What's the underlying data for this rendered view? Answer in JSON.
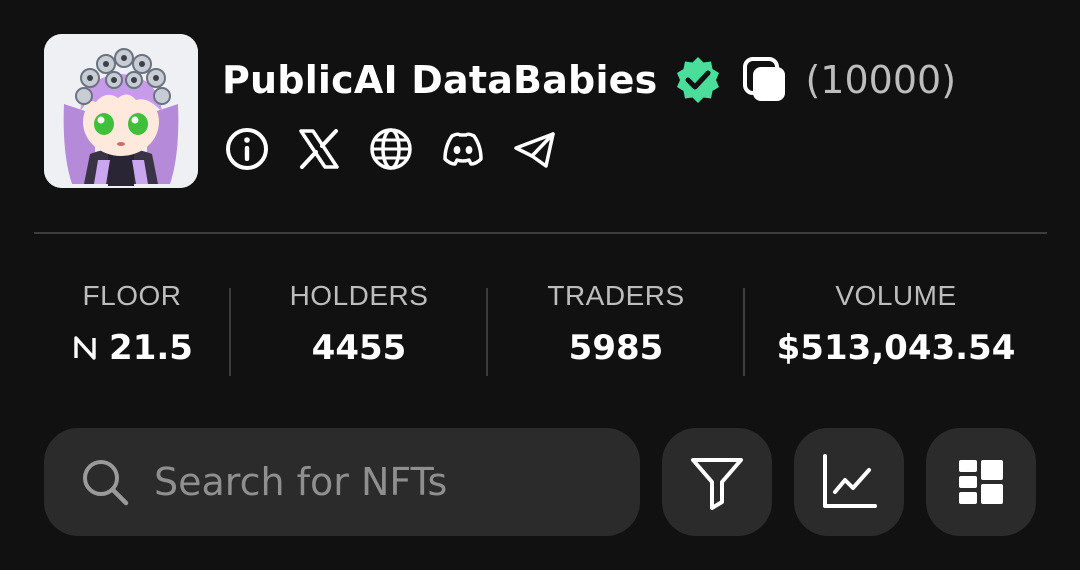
{
  "collection": {
    "name": "PublicAI DataBabies",
    "supply": "(10000)",
    "verified_color": "#4ade9a"
  },
  "socials": [
    {
      "name": "info-icon"
    },
    {
      "name": "x-twitter-icon"
    },
    {
      "name": "globe-icon"
    },
    {
      "name": "discord-icon"
    },
    {
      "name": "telegram-icon"
    }
  ],
  "stats": {
    "floor": {
      "label": "FLOOR",
      "value": "21.5",
      "currency_icon": "near-icon"
    },
    "holders": {
      "label": "HOLDERS",
      "value": "4455"
    },
    "traders": {
      "label": "TRADERS",
      "value": "5985"
    },
    "volume": {
      "label": "VOLUME",
      "value": "$513,043.54"
    }
  },
  "search": {
    "placeholder": "Search for NFTs",
    "value": ""
  },
  "toolbar": {
    "filter_icon": "filter-icon",
    "chart_icon": "chart-icon",
    "view_icon": "grid-view-icon"
  }
}
